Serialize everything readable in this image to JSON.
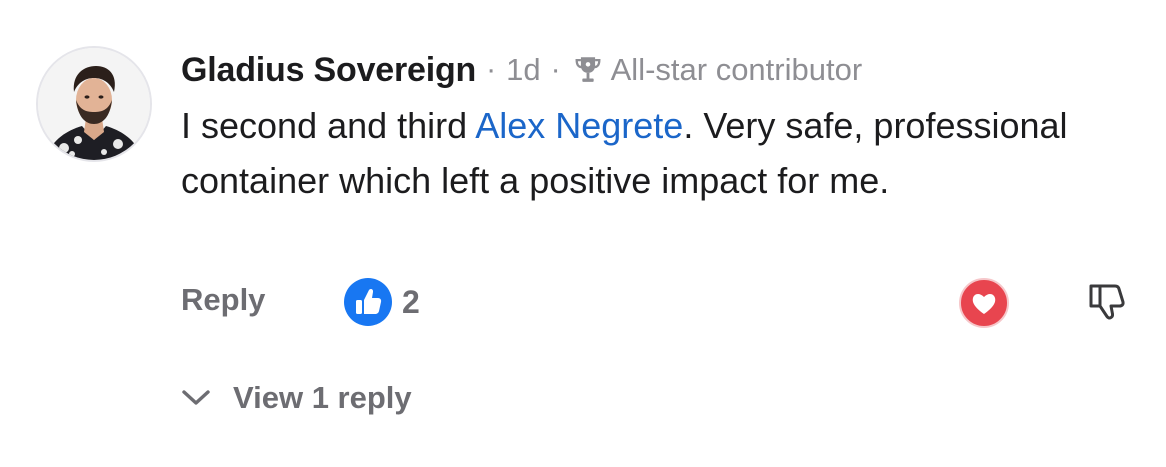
{
  "comment": {
    "author": "Gladius Sovereign",
    "separator": "·",
    "time": "1d",
    "badge": {
      "icon": "trophy-icon",
      "label": "All-star contributor"
    },
    "body": {
      "prefix": "I second and third ",
      "mention": "Alex Negrete",
      "suffix": ". Very safe, professional container which left a positive impact for me."
    },
    "actions": {
      "reply_label": "Reply",
      "like_icon": "thumbs-up-icon",
      "like_count": "2",
      "love_icon": "heart-icon",
      "dislike_icon": "thumbs-down-icon"
    },
    "replies": {
      "icon": "chevron-down-icon",
      "label": "View 1 reply"
    }
  },
  "colors": {
    "like_blue": "#1877f2",
    "love_red": "#e8454f",
    "mention_blue": "#1b66c9",
    "muted_gray": "#8e8e93",
    "action_gray": "#6d6d72"
  }
}
